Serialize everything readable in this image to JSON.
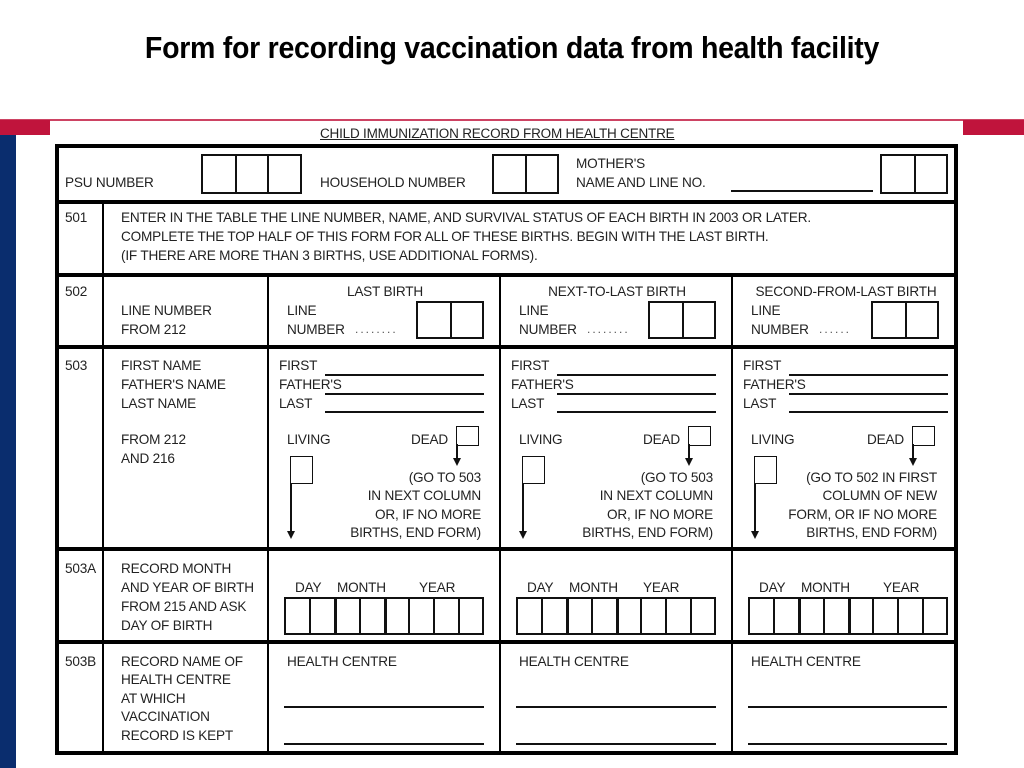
{
  "slide": {
    "title": "Form for recording vaccination data from health facility",
    "colors": {
      "accent_red": "#c0143c",
      "accent_blue": "#0a2d6e"
    }
  },
  "form": {
    "heading": "CHILD IMMUNIZATION RECORD FROM HEALTH CENTRE",
    "header": {
      "psu_label": "PSU NUMBER",
      "household_label": "HOUSEHOLD NUMBER",
      "mother_label_1": "MOTHER'S",
      "mother_label_2": "NAME AND LINE NO."
    },
    "q501": {
      "number": "501",
      "lines": [
        "ENTER IN THE TABLE THE LINE NUMBER, NAME, AND SURVIVAL STATUS OF EACH BIRTH IN 2003 OR LATER.",
        "COMPLETE THE TOP HALF OF THIS FORM FOR ALL OF THESE BIRTHS. BEGIN WITH THE LAST BIRTH.",
        "(IF THERE ARE MORE THAN 3 BIRTHS, USE ADDITIONAL FORMS)."
      ]
    },
    "q502": {
      "number": "502",
      "label_1": "LINE NUMBER",
      "label_2": "FROM 212",
      "columns": [
        {
          "title": "LAST BIRTH",
          "line": "LINE",
          "number": "NUMBER",
          "dots": "........"
        },
        {
          "title": "NEXT-TO-LAST BIRTH",
          "line": "LINE",
          "number": "NUMBER",
          "dots": "........"
        },
        {
          "title": "SECOND-FROM-LAST BIRTH",
          "line": "LINE",
          "number": "NUMBER",
          "dots": "......"
        }
      ]
    },
    "q503": {
      "number": "503",
      "labels": [
        "FIRST NAME",
        "FATHER'S NAME",
        "LAST NAME"
      ],
      "source_1": "FROM 212",
      "source_2": "AND 216",
      "columns": [
        {
          "first": "FIRST",
          "fathers": "FATHER'S",
          "last": "LAST",
          "living": "LIVING",
          "dead": "DEAD",
          "instruction": [
            "(GO TO 503",
            "IN NEXT COLUMN",
            "OR, IF NO MORE",
            "BIRTHS, END FORM)"
          ]
        },
        {
          "first": "FIRST",
          "fathers": "FATHER'S",
          "last": "LAST",
          "living": "LIVING",
          "dead": "DEAD",
          "instruction": [
            "(GO TO 503",
            "IN NEXT COLUMN",
            "OR, IF NO MORE",
            "BIRTHS, END FORM)"
          ]
        },
        {
          "first": "FIRST",
          "fathers": "FATHER'S",
          "last": "LAST",
          "living": "LIVING",
          "dead": "DEAD",
          "instruction": [
            "(GO TO 502 IN FIRST",
            "COLUMN OF NEW",
            "FORM, OR IF NO MORE",
            "BIRTHS, END FORM)"
          ]
        }
      ]
    },
    "q503a": {
      "number": "503A",
      "labels": [
        "RECORD MONTH",
        "AND YEAR OF BIRTH",
        "FROM 215 AND ASK",
        "DAY OF BIRTH"
      ],
      "columns": [
        {
          "day": "DAY",
          "month": "MONTH",
          "year": "YEAR"
        },
        {
          "day": "DAY",
          "month": "MONTH",
          "year": "YEAR"
        },
        {
          "day": "DAY",
          "month": "MONTH",
          "year": "YEAR"
        }
      ]
    },
    "q503b": {
      "number": "503B",
      "labels": [
        "RECORD NAME OF",
        "HEALTH CENTRE",
        "AT WHICH",
        "VACCINATION",
        "RECORD IS KEPT"
      ],
      "columns": [
        {
          "label": "HEALTH CENTRE"
        },
        {
          "label": "HEALTH CENTRE"
        },
        {
          "label": "HEALTH CENTRE"
        }
      ]
    }
  }
}
